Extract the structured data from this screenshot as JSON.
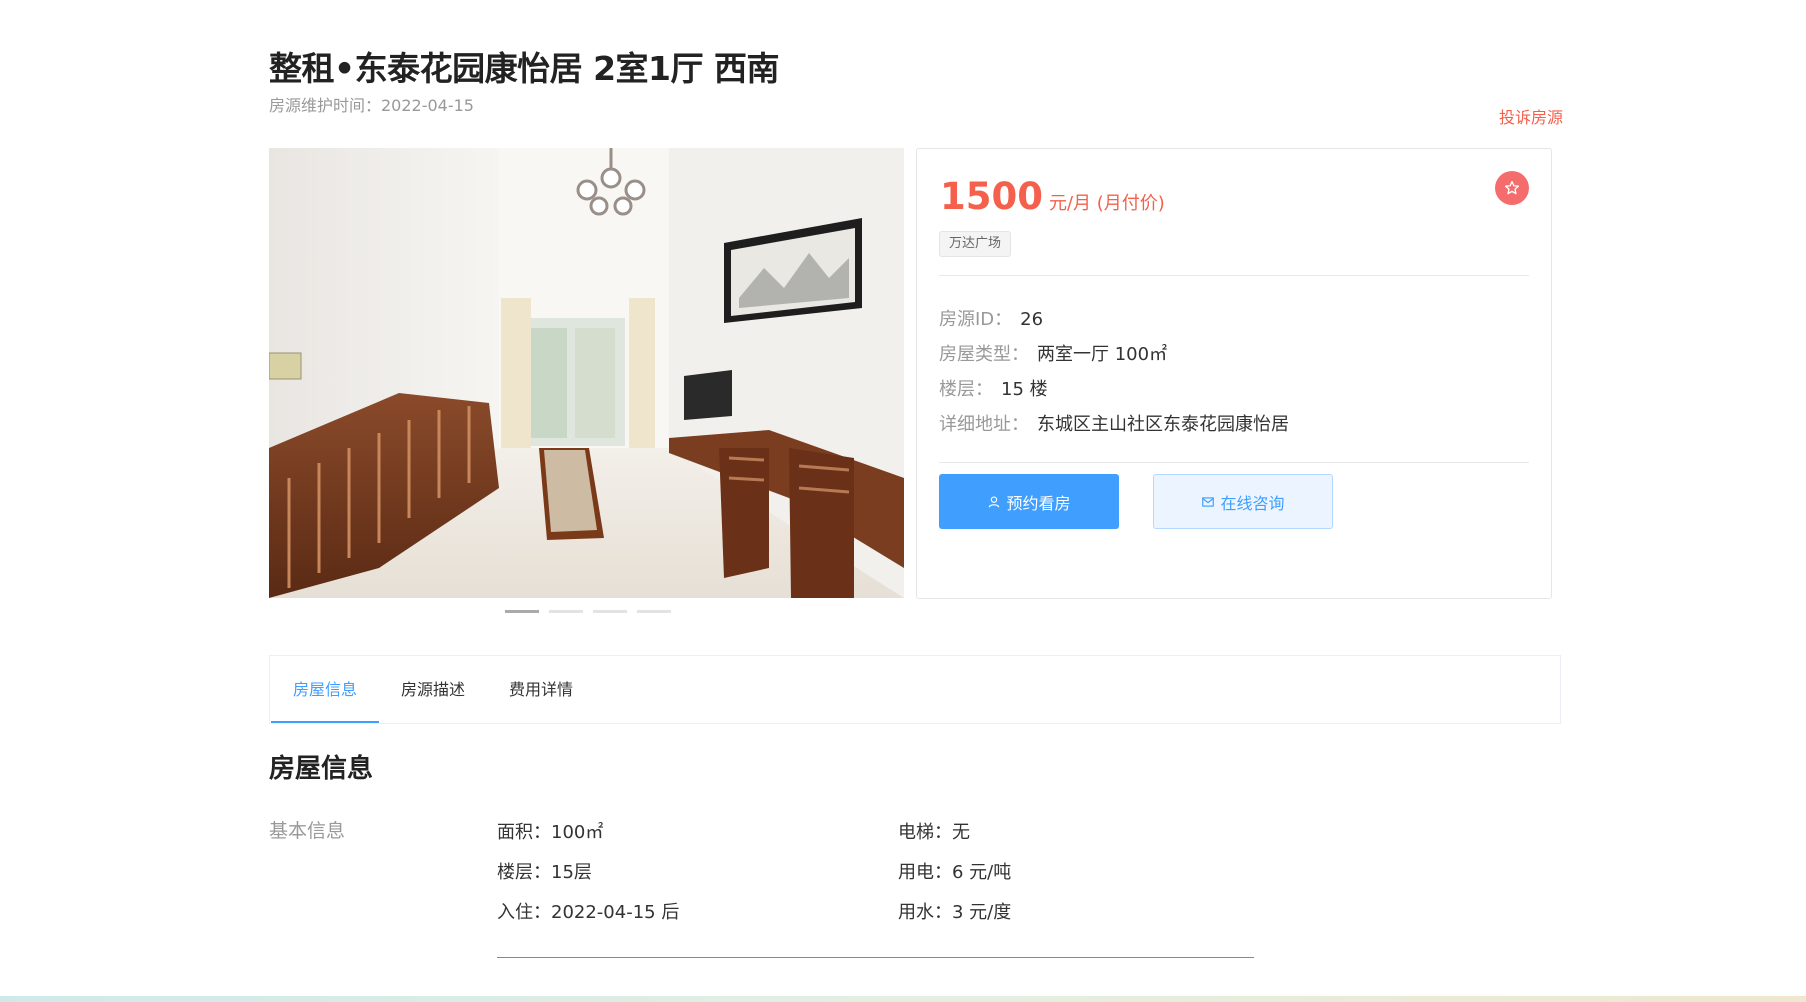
{
  "listing": {
    "title": "整租•东泰花园康怡居 2室1厅 西南",
    "maintained": "房源维护时间：2022-04-15",
    "complain": "投诉房源"
  },
  "gallery": {
    "slide_count": 4,
    "active_index": 0
  },
  "summary": {
    "price": "1500",
    "price_unit": "元/月 (月付价)",
    "tag": "万达广场",
    "fields": [
      {
        "label": "房源ID：",
        "value": "26"
      },
      {
        "label": "房屋类型：",
        "value": "两室一厅 100㎡"
      },
      {
        "label": "楼层：",
        "value": "15 楼"
      },
      {
        "label": "详细地址：",
        "value": "东城区主山社区东泰花园康怡居"
      }
    ],
    "buttons": {
      "book": "预约看房",
      "consult": "在线咨询"
    }
  },
  "tabs": [
    {
      "label": "房屋信息",
      "active": true
    },
    {
      "label": "房源描述",
      "active": false
    },
    {
      "label": "费用详情",
      "active": false
    }
  ],
  "details": {
    "section_title": "房屋信息",
    "basic_label": "基本信息",
    "left": [
      "面积：100㎡",
      "楼层：15层",
      "入住：2022-04-15 后"
    ],
    "right": [
      "电梯：无",
      "用电：6 元/吨",
      "用水：3 元/度"
    ]
  },
  "colors": {
    "accent": "#409eff",
    "price": "#f4604c",
    "favorite": "#f56c6c"
  },
  "icons": {
    "favorite": "star-icon",
    "book": "user-icon",
    "consult": "mail-icon"
  }
}
